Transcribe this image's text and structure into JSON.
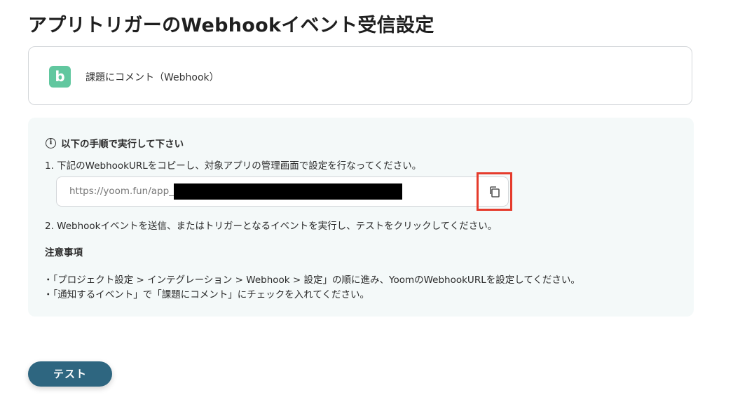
{
  "page": {
    "title": "アプリトリガーのWebhookイベント受信設定"
  },
  "app_card": {
    "logo_letter": "b",
    "logo_color": "#61c79f",
    "trigger_name": "課題にコメント（Webhook）"
  },
  "instructions": {
    "heading": "以下の手順で実行して下さい",
    "info_icon": "info-icon",
    "step1": "1. 下記のWebhookURLをコピーし、対象アプリの管理画面で設定を行なってください。",
    "webhook_url": "https://yoom.fun/app_t",
    "copy_icon": "copy-icon",
    "step2": "2. Webhookイベントを送信、またはトリガーとなるイベントを実行し、テストをクリックしてください。",
    "notes_title": "注意事項",
    "notes": [
      "・「プロジェクト設定 > インテグレーション > Webhook > 設定」の順に進み、YoomのWebhookURLを設定してください。",
      "・「通知するイベント」で「課題にコメント」にチェックを入れてください。"
    ]
  },
  "actions": {
    "test_label": "テスト"
  },
  "colors": {
    "accent": "#2e6680",
    "highlight": "#e53b2c",
    "panel_bg": "#f4f9f9"
  }
}
